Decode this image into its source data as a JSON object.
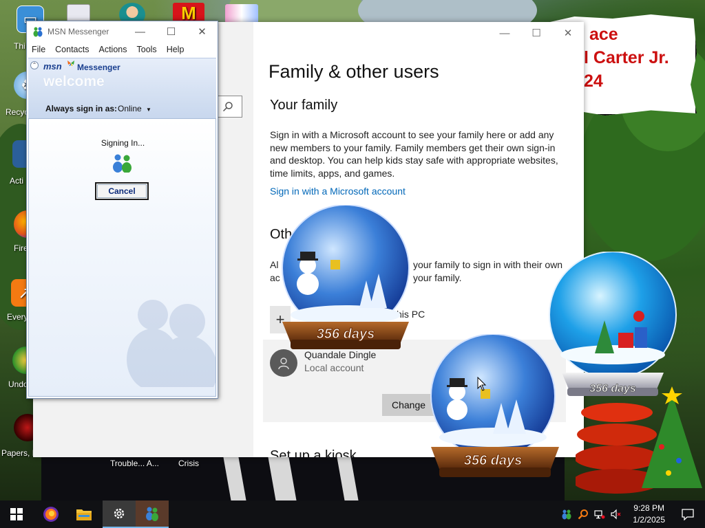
{
  "desktop": {
    "sign": {
      "lines": [
        "ace",
        "l Carter Jr.",
        "24"
      ]
    },
    "icons": [
      {
        "label": "Thi",
        "icon": "this-pc-icon"
      },
      {
        "label": "Recyc",
        "icon": "recycle-bin-icon"
      },
      {
        "label": "Acti",
        "icon": "activate-icon"
      },
      {
        "label": "Fire",
        "icon": "firefox-shortcut-icon"
      },
      {
        "label": "Every",
        "icon": "everything-shortcut-icon"
      },
      {
        "label": "Undo",
        "icon": "undo-shortcut-icon"
      },
      {
        "label": "Papers, P",
        "icon": "papers-please-shortcut-icon"
      }
    ],
    "bottom_labels": [
      "Trouble... A...",
      "Crisis"
    ]
  },
  "settings_window": {
    "page_title": "Family & other users",
    "family_heading": "Your family",
    "family_text": "Sign in with a Microsoft account to see your family here or add any new members to your family. Family members get their own sign-in and desktop. You can help kids stay safe with appropriate websites, time limits, apps, and games.",
    "family_link": "Sign in with a Microsoft account",
    "other_heading_partial": "Oth",
    "other_text_line1_left": "Al",
    "other_text_line1_right": "your family to sign in with their own",
    "other_text_line2_left": "ac",
    "other_text_line2_right": "your family.",
    "add_user_partial": "his PC",
    "account": {
      "name": "Quandale Dingle",
      "type": "Local account"
    },
    "change_button": "Change",
    "kiosk_heading_partial": "Set up a kiosk"
  },
  "msn": {
    "title": "MSN Messenger",
    "menu": [
      "File",
      "Contacts",
      "Actions",
      "Tools",
      "Help"
    ],
    "logo_text": "msn",
    "logo_word": "Messenger",
    "welcome": "welcome",
    "signin_as_label": "Always sign in as:",
    "status": "Online",
    "signing_in": "Signing In...",
    "cancel": "Cancel"
  },
  "globes": [
    {
      "label": "356 days"
    },
    {
      "label": "356 days"
    },
    {
      "label": "356 days"
    }
  ],
  "taskbar": {
    "items": [
      {
        "name": "start-button",
        "icon": "windows-icon"
      },
      {
        "name": "taskbar-firefox",
        "icon": "firefox-icon"
      },
      {
        "name": "taskbar-file-explorer",
        "icon": "folder-icon"
      },
      {
        "name": "taskbar-settings",
        "icon": "gear-icon"
      },
      {
        "name": "taskbar-msn-messenger",
        "icon": "msn-buddy-icon"
      }
    ],
    "time": "9:28 PM",
    "date": "1/2/2025"
  },
  "colors": {
    "link": "#0067b8",
    "msn_blue": "#1a3f8f",
    "taskbar": "#101114",
    "sign_text": "#cc1010"
  }
}
